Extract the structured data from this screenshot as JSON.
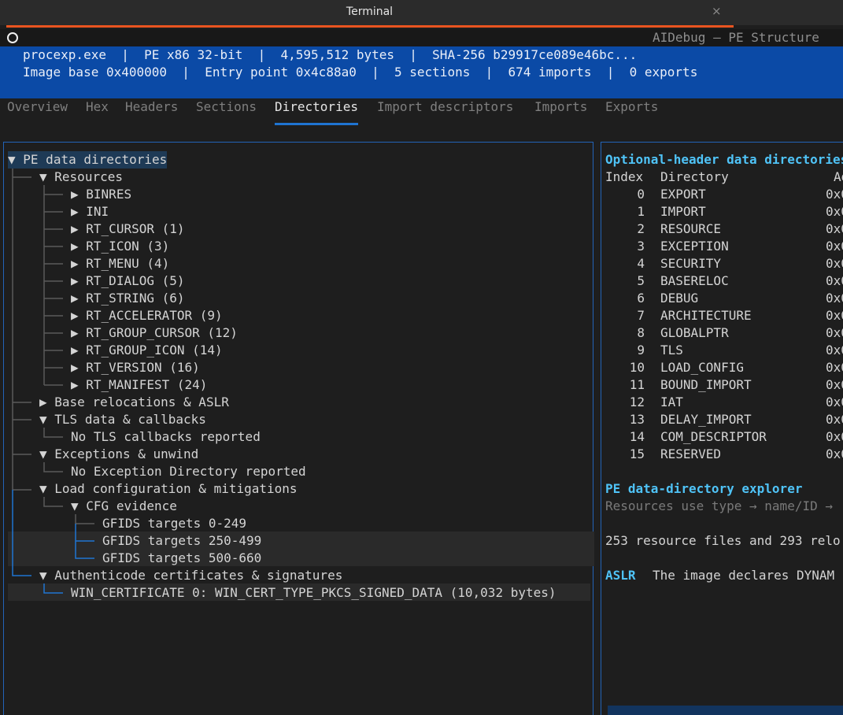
{
  "window": {
    "title": "Terminal",
    "close_glyph": "×",
    "accent_color": "#e95420"
  },
  "app": {
    "title": "AIDebug — PE Structure"
  },
  "banner": {
    "line1": "procexp.exe  |  PE x86 32-bit  |  4,595,512 bytes  |  SHA-256 b29917ce089e46bc...",
    "line2": "Image base 0x400000  |  Entry point 0x4c88a0  |  5 sections  |  674 imports  |  0 exports",
    "color": "#0b4aa6"
  },
  "tabs": [
    {
      "label": "Overview",
      "active": false
    },
    {
      "label": "Hex",
      "active": false
    },
    {
      "label": "Headers",
      "active": false
    },
    {
      "label": "Sections",
      "active": false
    },
    {
      "label": "Directories",
      "active": true
    },
    {
      "label": "Import descriptors",
      "active": false
    },
    {
      "label": "Imports",
      "active": false
    },
    {
      "label": "Exports",
      "active": false
    }
  ],
  "tree": {
    "root": "PE data directories",
    "resources": {
      "label": "Resources",
      "items": [
        "BINRES",
        "INI",
        "RT_CURSOR (1)",
        "RT_ICON (3)",
        "RT_MENU (4)",
        "RT_DIALOG (5)",
        "RT_STRING (6)",
        "RT_ACCELERATOR (9)",
        "RT_GROUP_CURSOR (12)",
        "RT_GROUP_ICON (14)",
        "RT_VERSION (16)",
        "RT_MANIFEST (24)"
      ]
    },
    "base_reloc": "Base relocations & ASLR",
    "tls": {
      "label": "TLS data & callbacks",
      "child": "No TLS callbacks reported"
    },
    "exceptions": {
      "label": "Exceptions & unwind",
      "child": "No Exception Directory reported"
    },
    "load_config": {
      "label": "Load configuration & mitigations",
      "cfg": {
        "label": "CFG evidence",
        "items": [
          "GFIDS targets 0-249",
          "GFIDS targets 250-499",
          "GFIDS targets 500-660"
        ]
      }
    },
    "authenticode": {
      "label": "Authenticode certificates & signatures",
      "child": "WIN_CERTIFICATE 0: WIN_CERT_TYPE_PKCS_SIGNED_DATA (10,032 bytes)"
    },
    "expanded_glyph": "▼",
    "collapsed_glyph": "▶"
  },
  "directories": {
    "heading": "Optional-header data directories",
    "columns": [
      "Index",
      "Directory",
      "Ad"
    ],
    "rows": [
      {
        "index": "0",
        "name": "EXPORT",
        "addr": "0x0"
      },
      {
        "index": "1",
        "name": "IMPORT",
        "addr": "0x0"
      },
      {
        "index": "2",
        "name": "RESOURCE",
        "addr": "0x0"
      },
      {
        "index": "3",
        "name": "EXCEPTION",
        "addr": "0x0"
      },
      {
        "index": "4",
        "name": "SECURITY",
        "addr": "0x0"
      },
      {
        "index": "5",
        "name": "BASERELOC",
        "addr": "0x0"
      },
      {
        "index": "6",
        "name": "DEBUG",
        "addr": "0x0"
      },
      {
        "index": "7",
        "name": "ARCHITECTURE",
        "addr": "0x0"
      },
      {
        "index": "8",
        "name": "GLOBALPTR",
        "addr": "0x0"
      },
      {
        "index": "9",
        "name": "TLS",
        "addr": "0x0"
      },
      {
        "index": "10",
        "name": "LOAD_CONFIG",
        "addr": "0x0"
      },
      {
        "index": "11",
        "name": "BOUND_IMPORT",
        "addr": "0x0"
      },
      {
        "index": "12",
        "name": "IAT",
        "addr": "0x0"
      },
      {
        "index": "13",
        "name": "DELAY_IMPORT",
        "addr": "0x0"
      },
      {
        "index": "14",
        "name": "COM_DESCRIPTOR",
        "addr": "0x0"
      },
      {
        "index": "15",
        "name": "RESERVED",
        "addr": "0x0"
      }
    ],
    "explorer_heading": "PE data-directory explorer",
    "explorer_hint": "Resources use type → name/ID →",
    "resource_summary": "253 resource files and 293 relo",
    "aslr_label": "ASLR",
    "aslr_text": "The image declares DYNAM"
  }
}
